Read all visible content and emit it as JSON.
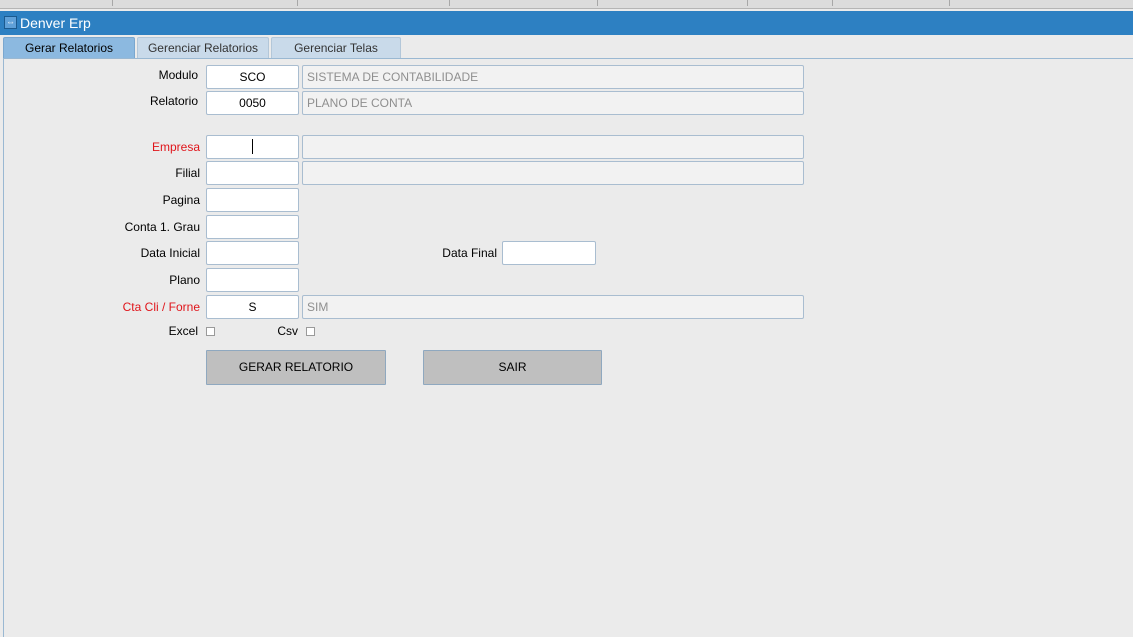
{
  "window": {
    "title": "Denver Erp",
    "icon": "window-restore-icon"
  },
  "tabs": [
    {
      "label": "Gerar Relatorios",
      "active": true
    },
    {
      "label": "Gerenciar Relatorios",
      "active": false
    },
    {
      "label": "Gerenciar Telas",
      "active": false
    }
  ],
  "form": {
    "modulo": {
      "label": "Modulo",
      "code": "SCO",
      "description": "SISTEMA DE CONTABILIDADE"
    },
    "relatorio": {
      "label": "Relatorio",
      "code": "0050",
      "description": "PLANO DE CONTA"
    },
    "empresa": {
      "label": "Empresa",
      "code": "",
      "description": ""
    },
    "filial": {
      "label": "Filial",
      "code": "",
      "description": ""
    },
    "pagina": {
      "label": "Pagina",
      "value": ""
    },
    "conta_grau": {
      "label": "Conta 1. Grau",
      "value": ""
    },
    "data_inicial": {
      "label": "Data Inicial",
      "value": ""
    },
    "data_final": {
      "label": "Data Final",
      "value": ""
    },
    "plano": {
      "label": "Plano",
      "value": ""
    },
    "cta_cli_forne": {
      "label": "Cta Cli / Forne",
      "code": "S",
      "description": "SIM"
    },
    "excel": {
      "label": "Excel",
      "checked": false
    },
    "csv": {
      "label": "Csv",
      "checked": false
    }
  },
  "buttons": {
    "gerar": "GERAR RELATORIO",
    "sair": "SAIR"
  },
  "colors": {
    "titlebar": "#2d80c2",
    "required_label": "#e0151b",
    "active_tab": "#8cb9e0"
  }
}
